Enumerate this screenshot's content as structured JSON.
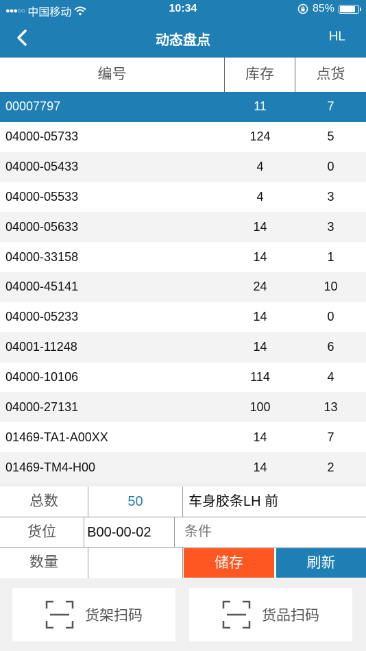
{
  "status_bar": {
    "carrier": "中国移动",
    "time": "10:34",
    "battery": "85%",
    "battery_level": 0.85
  },
  "nav": {
    "title": "动态盘点",
    "right": "HL"
  },
  "columns": {
    "code": "编号",
    "stock": "库存",
    "counted": "点货"
  },
  "rows": [
    {
      "code": "00007797",
      "stock": "11",
      "counted": "7",
      "selected": true
    },
    {
      "code": "04000-05733",
      "stock": "124",
      "counted": "5"
    },
    {
      "code": "04000-05433",
      "stock": "4",
      "counted": "0"
    },
    {
      "code": "04000-05533",
      "stock": "4",
      "counted": "3"
    },
    {
      "code": "04000-05633",
      "stock": "14",
      "counted": "3"
    },
    {
      "code": "04000-33158",
      "stock": "14",
      "counted": "1"
    },
    {
      "code": "04000-45141",
      "stock": "24",
      "counted": "10"
    },
    {
      "code": "04000-05233",
      "stock": "14",
      "counted": "0"
    },
    {
      "code": "04001-11248",
      "stock": "14",
      "counted": "6"
    },
    {
      "code": "04000-10106",
      "stock": "114",
      "counted": "4"
    },
    {
      "code": "04000-27131",
      "stock": "100",
      "counted": "13"
    },
    {
      "code": "01469-TA1-A00XX",
      "stock": "14",
      "counted": "7"
    },
    {
      "code": "01469-TM4-H00",
      "stock": "14",
      "counted": "2"
    }
  ],
  "form": {
    "total_label": "总数",
    "total_value": "50",
    "description": "车身胶条LH 前",
    "location_label": "货位",
    "location_value": "B00-00-02",
    "condition_placeholder": "条件",
    "quantity_label": "数量",
    "save_label": "储存",
    "refresh_label": "刷新"
  },
  "scan": {
    "shelf_label": "货架扫码",
    "goods_label": "货品扫码"
  },
  "colors": {
    "primary": "#1f7fb5",
    "accent": "#ff5722"
  }
}
